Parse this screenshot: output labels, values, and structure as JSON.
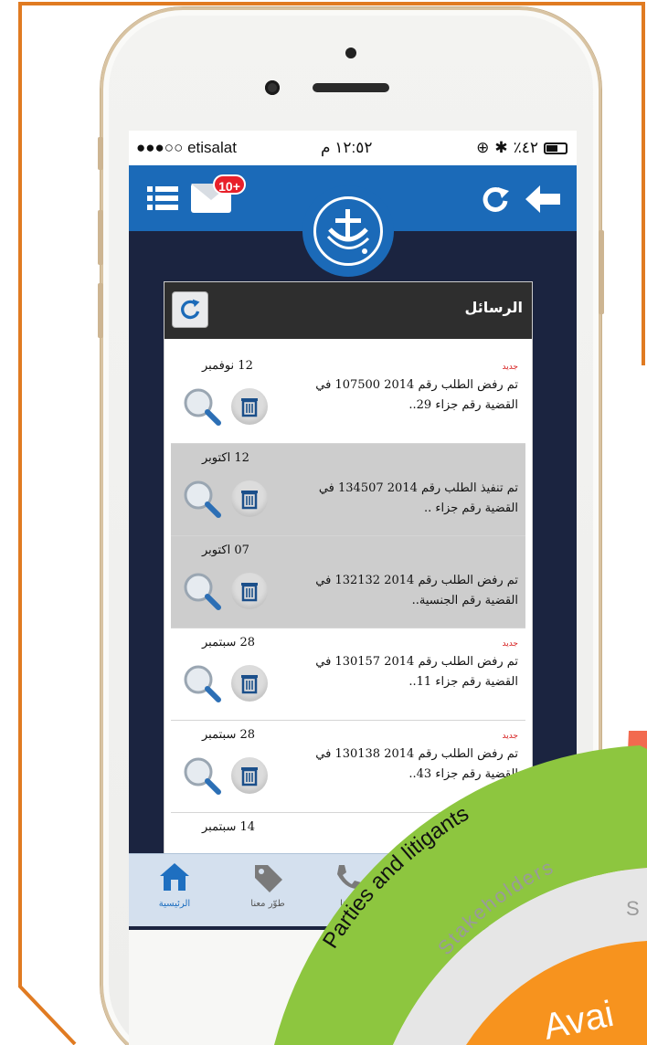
{
  "status_bar": {
    "carrier": "●●●○○ etisalat",
    "time": "١٢:٥٢ م",
    "battery": "٪٤٢"
  },
  "app_bar": {
    "badge": "10+"
  },
  "messages": {
    "title": "الرسائل",
    "items": [
      {
        "date": "12 نوفمبر",
        "new_label": "جديد",
        "text": "تم رفض الطلب رقم 2014 107500 في القضية رقم جزاء 29..",
        "highlighted": false
      },
      {
        "date": "12 اكتوبر",
        "new_label": "",
        "text": "تم تنفيذ الطلب رقم 2014 134507 في القضية رقم جزاء ..",
        "highlighted": true
      },
      {
        "date": "07 اكتوبر",
        "new_label": "",
        "text": "تم رفض الطلب رقم 2014 132132 في القضية رقم الجنسية..",
        "highlighted": true
      },
      {
        "date": "28 سبتمبر",
        "new_label": "جديد",
        "text": "تم رفض الطلب رقم 2014 130157 في القضية رقم جزاء 11..",
        "highlighted": false
      },
      {
        "date": "28 سبتمبر",
        "new_label": "جديد",
        "text": "تم رفض الطلب رقم 2014 130138 في القضية رقم جزاء 43..",
        "highlighted": false
      },
      {
        "date": "14 سبتمبر",
        "new_label": "",
        "text": "",
        "highlighted": false
      }
    ]
  },
  "tabbar": {
    "home": "الرئيسية",
    "develop": "طوّر معنا",
    "contact": "صلنا"
  },
  "overlay": {
    "arc_text": "Parties and litigants",
    "ring_text": "Stakeholders",
    "ring_text_2": "S",
    "center_text": "Avai"
  },
  "colors": {
    "frame": "#e07b22",
    "app_blue": "#1b6ab8",
    "screen_bg": "#1b2440",
    "green_arc": "#8dc63f",
    "orange_center": "#f7931e"
  }
}
